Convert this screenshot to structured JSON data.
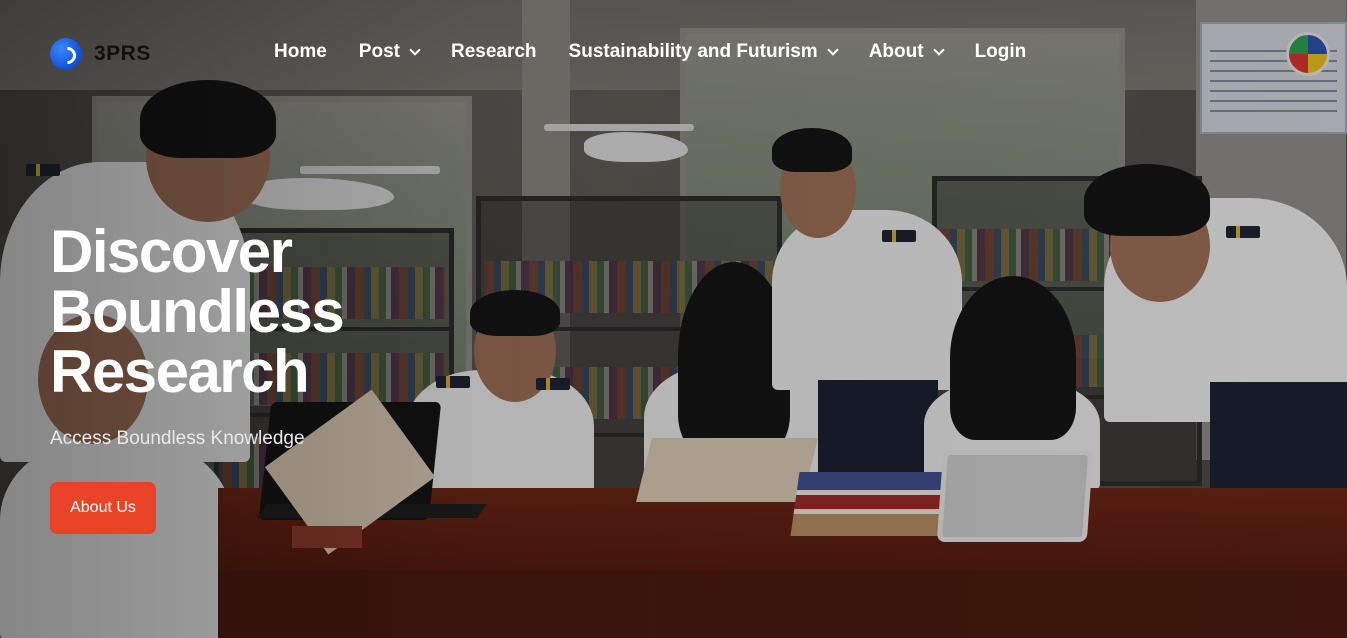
{
  "brand": {
    "name": "3PRS",
    "icon": "circular-logo-icon"
  },
  "nav": {
    "items": [
      {
        "label": "Home",
        "dropdown": false
      },
      {
        "label": "Post",
        "dropdown": true
      },
      {
        "label": "Research",
        "dropdown": false
      },
      {
        "label": "Sustainability and Futurism",
        "dropdown": true
      },
      {
        "label": "About",
        "dropdown": true
      },
      {
        "label": "Login",
        "dropdown": false
      }
    ]
  },
  "hero": {
    "title_line1": "Discover",
    "title_line2": "Boundless",
    "title_line3": "Research",
    "subtitle": "Access Boundless Knowledge",
    "button_label": "About Us"
  },
  "colors": {
    "accent": "#e94428",
    "brand_blue": "#1456d8"
  }
}
